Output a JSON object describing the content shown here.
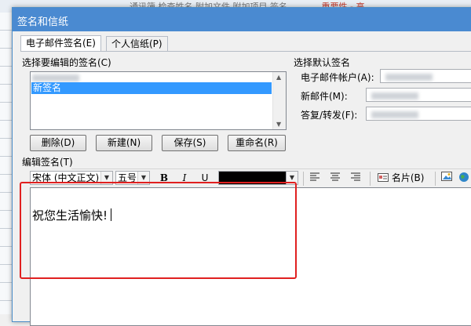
{
  "background": {
    "strip_text": "通讯簿  检查姓名  附加文件  附加项目  签名",
    "flag_text": "重要性 - 高"
  },
  "dialog": {
    "title": "签名和信纸"
  },
  "tabs": [
    {
      "label": "电子邮件签名(E)",
      "active": true
    },
    {
      "label": "个人信纸(P)",
      "active": false
    }
  ],
  "select_signature": {
    "label": "选择要编辑的签名(C)",
    "items": [
      {
        "label": "",
        "redacted": true
      },
      {
        "label": "新签名",
        "selected": true
      }
    ]
  },
  "buttons": {
    "delete": "删除(D)",
    "new": "新建(N)",
    "save": "保存(S)",
    "rename": "重命名(R)"
  },
  "defaults": {
    "label": "选择默认签名",
    "account_label": "电子邮件帐户(A):",
    "new_messages_label": "新邮件(M):",
    "replies_label": "答复/转发(F):"
  },
  "edit_signature": {
    "label": "编辑签名(T)"
  },
  "toolbar": {
    "font": "宋体 (中文正文)",
    "size": "五号",
    "bold": "B",
    "italic": "I",
    "underline": "U",
    "font_color": "#000000",
    "business_card": "名片(B)"
  },
  "editor": {
    "content": "祝您生活愉快!"
  },
  "colors": {
    "titlebar": "#4a8ad1",
    "selection": "#3399ff",
    "highlight_box": "#e02020"
  }
}
